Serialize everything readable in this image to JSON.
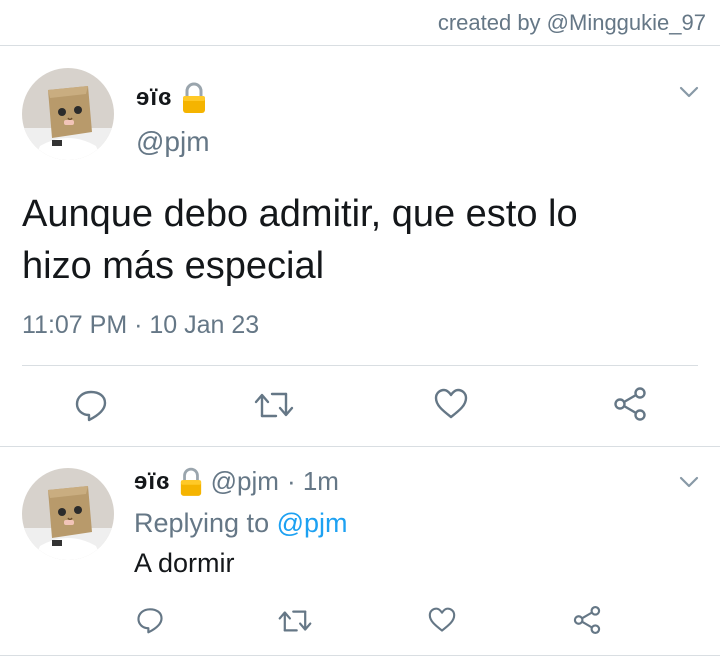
{
  "header": {
    "credit": "created by @Minggukie_97"
  },
  "main_tweet": {
    "display_name": "ɘïɞ",
    "handle": "@pjm",
    "text_line1": "Aunque debo admitir, que esto lo",
    "text_line2": "hizo más especial",
    "timestamp": "11:07 PM · 10 Jan 23"
  },
  "reply_tweet": {
    "display_name": "ɘïɞ",
    "handle": "@pjm",
    "time": "· 1m",
    "replying_prefix": "Replying to",
    "replying_to": "@pjm",
    "text": "A dormir"
  },
  "icons": {
    "reply": "reply-icon",
    "retweet": "retweet-icon",
    "like": "heart-icon",
    "share": "share-icon",
    "lock": "lock-icon",
    "menu": "chevron-down-icon"
  },
  "colors": {
    "accent": "#1da1f2",
    "muted": "#657786",
    "divider": "#d9dee2",
    "lock": "#f5b400"
  }
}
